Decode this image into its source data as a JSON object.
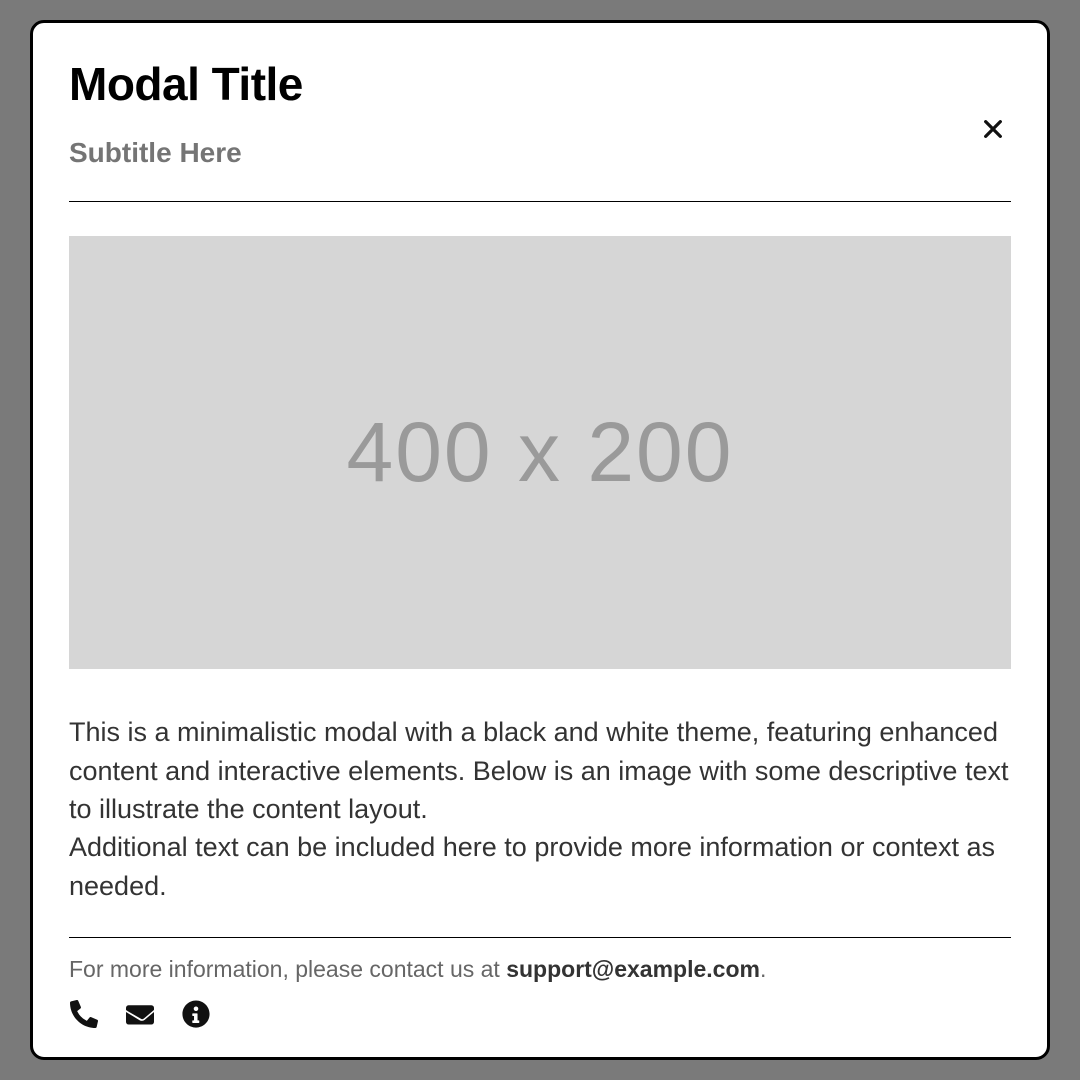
{
  "modal": {
    "title": "Modal Title",
    "subtitle": "Subtitle Here",
    "close_label": "Close"
  },
  "image": {
    "placeholder_text": "400 x 200"
  },
  "body": {
    "p1": "This is a minimalistic modal with a black and white theme, featuring enhanced content and interactive elements. Below is an image with some descriptive text to illustrate the content layout.",
    "p2": "Additional text can be included here to provide more information or context as needed."
  },
  "footer": {
    "prefix": "For more information, please contact us at ",
    "email": "support@example.com",
    "suffix": "."
  },
  "icons": {
    "phone": "phone-icon",
    "envelope": "envelope-icon",
    "info": "info-icon"
  }
}
